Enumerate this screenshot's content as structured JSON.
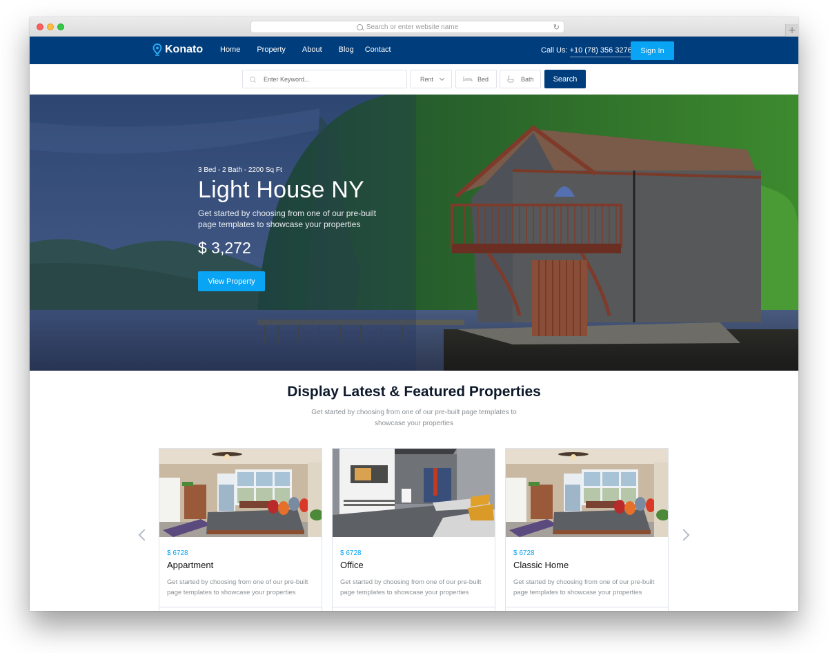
{
  "browser": {
    "url_placeholder": "Search or enter website name",
    "new_tab_label": "+"
  },
  "navbar": {
    "brand": "Konato",
    "links": [
      "Home",
      "Property",
      "About",
      "Blog",
      "Contact"
    ],
    "call_label": "Call Us:",
    "phone": "+10 (78) 356 3276",
    "signin_label": "Sign In",
    "colors": {
      "primary": "#003d7c",
      "accent": "#0aa4f5"
    }
  },
  "search": {
    "keyword_placeholder": "Enter Keyword...",
    "type_selected": "Rent",
    "bed_label": "Bed",
    "bath_label": "Bath",
    "button_label": "Search",
    "icons": {
      "keyword": "search-icon",
      "type": "chevron-down-icon",
      "bed": "bed-icon",
      "bath": "bathtub-icon"
    }
  },
  "hero": {
    "meta": "3 Bed - 2 Bath - 2200 Sq Ft",
    "title": "Light House NY",
    "description": "Get started by choosing from one of our pre-built page templates to showcase your properties",
    "price": "$ 3,272",
    "button_label": "View Property"
  },
  "featured": {
    "title": "Display Latest & Featured Properties",
    "subtitle": "Get started by choosing from one of our pre-built page templates to showcase your properties",
    "cards": [
      {
        "price": "$ 6728",
        "name": "Appartment",
        "description": "Get started by choosing from one of our pre-built page templates to showcase your properties",
        "image": "bedroom-photo"
      },
      {
        "price": "$ 6728",
        "name": "Office",
        "description": "Get started by choosing from one of our pre-built page templates to showcase your properties",
        "image": "modern-living-room-photo"
      },
      {
        "price": "$ 6728",
        "name": "Classic Home",
        "description": "Get started by choosing from one of our pre-built page templates to showcase your properties",
        "image": "bedroom-photo"
      }
    ]
  }
}
